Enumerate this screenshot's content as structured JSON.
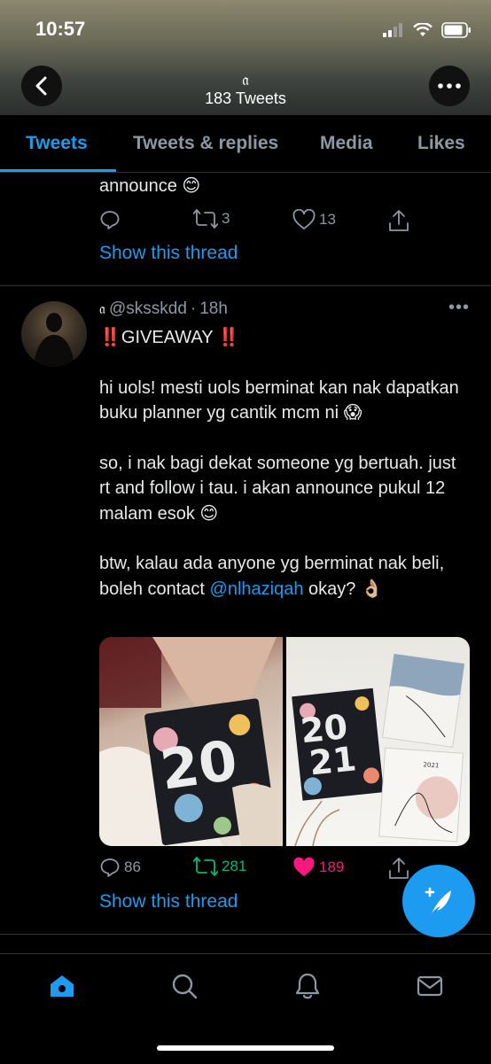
{
  "status_bar": {
    "time": "10:57"
  },
  "header": {
    "title_glyph": "𝔞",
    "tweet_count": "183 Tweets"
  },
  "tabs": [
    {
      "label": "Tweets",
      "active": true
    },
    {
      "label": "Tweets & replies",
      "active": false
    },
    {
      "label": "Media",
      "active": false
    },
    {
      "label": "Likes",
      "active": false
    }
  ],
  "previous_tweet": {
    "text_tail": "announce 😊",
    "retweets": "3",
    "likes": "13",
    "show_thread": "Show this thread"
  },
  "tweet": {
    "author_glyph": "𝔞",
    "handle": "@sksskdd",
    "time_sep": "·",
    "time": "18h",
    "more": "•••",
    "line1": "‼️GIVEAWAY ‼️",
    "para1": "hi uols! mesti uols berminat kan nak dapatkan buku planner yg cantik mcm ni 😱",
    "para2": "so, i nak bagi dekat someone yg bertuah. just rt and follow i tau. i akan announce pukul 12 malam esok 😊",
    "para3_before": "btw, kalau ada anyone yg berminat nak beli, boleh contact ",
    "para3_mention": "@nlhaziqah",
    "para3_after": " okay? 👌🏼",
    "photo2_year": "2021",
    "replies": "86",
    "retweets": "281",
    "likes": "189",
    "show_thread": "Show this thread"
  },
  "colors": {
    "accent": "#1d9bf0",
    "retweet": "#00ba7c",
    "like": "#f91880"
  },
  "bottom_nav": [
    "home-icon",
    "search-icon",
    "bell-icon",
    "mail-icon"
  ]
}
